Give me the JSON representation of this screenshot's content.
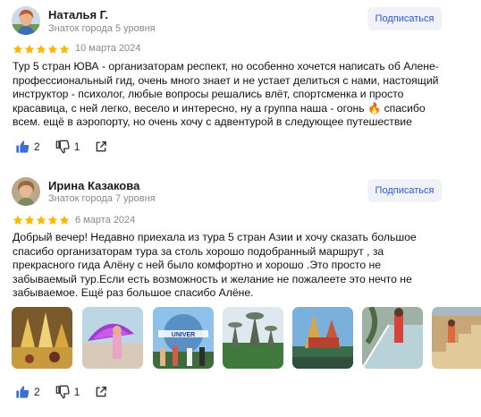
{
  "reviews": [
    {
      "name": "Наталья Г.",
      "level": "Знаток города 5 уровня",
      "subscribe_label": "Подписаться",
      "rating": 5,
      "date": "10 марта 2024",
      "text": "Тур 5 стран ЮВА - организаторам респект, но особенно хочется написать об Алене-профессиональный гид, очень много знает и не устает делиться с нами, настоящий инструктор - психолог, любые вопросы решались влёт, спортсменка и просто красавица, с ней легко, весело и интересно, ну а группа наша - огонь 🔥 спасибо всем. ещё в аэропорту, но очень хочу с адвентурой в следующее путешествие",
      "likes": "2",
      "dislikes": "1"
    },
    {
      "name": "Ирина Казакова",
      "level": "Знаток города 7 уровня",
      "subscribe_label": "Подписаться",
      "rating": 5,
      "date": "6 марта 2024",
      "text": "Добрый вечер! Недавно приехала из тура 5 стран Азии и хочу сказать большое спасибо организаторам тура за столь хорошо подобранный маршрут , за прекрасного гида Алёну с ней было комфортно и хорошо .Это просто не забываемый тур.Если есть возможность и желание не пожалеете это нечто не забываемое. Ещё раз большое спасибо Алёне.",
      "likes": "2",
      "dislikes": "1",
      "photos": [
        "temple-gold",
        "purple-umbrella",
        "universal-globe",
        "gardens-supertrees",
        "temple-lake",
        "glass-walkway",
        "stairs-temple"
      ]
    }
  ],
  "colors": {
    "star": "#fcb800",
    "accent": "#2a5bd7",
    "like": "#3b6fd6",
    "button_bg": "#f0f2f7"
  }
}
